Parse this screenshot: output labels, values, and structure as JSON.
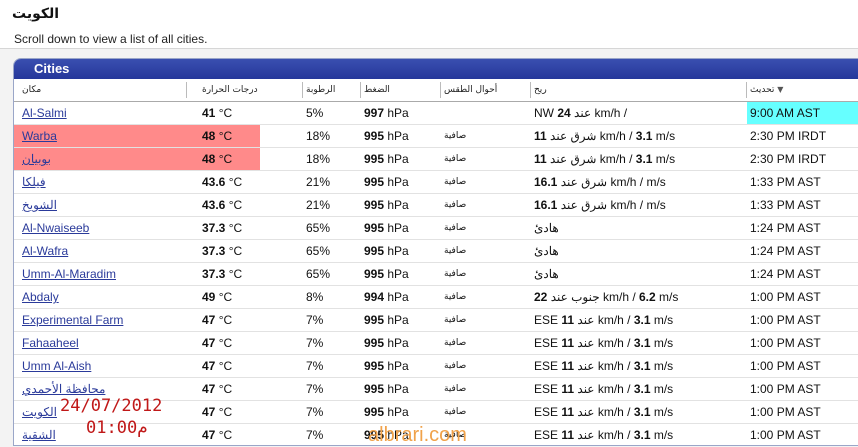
{
  "page": {
    "title": "الكويت",
    "hint": "Scroll down to view a list of all cities."
  },
  "panel": {
    "title": "Cities"
  },
  "columns": {
    "place": "مكان",
    "temperature": "درجات الحرارة",
    "humidity": "الرطوبة",
    "pressure": "الضغط",
    "conditions": "أحوال الطقس",
    "wind": "ريح",
    "updated": "تحديث"
  },
  "rows": [
    {
      "city": "Al-Salmi",
      "temp": "41",
      "temp_unit": " °C",
      "humidity": "5%",
      "pressure": "997",
      "pressure_unit": " hPa",
      "conditions": "",
      "wind_pre": "NW ",
      "wind_speed": "24",
      "wind_mid": " عند km/h / ",
      "wind_ms": "",
      "wind_post": "",
      "updated": "9:00 AM AST",
      "highlight": false,
      "highlight_updated": true
    },
    {
      "city": "Warba",
      "temp": "48",
      "temp_unit": " °C",
      "humidity": "18%",
      "pressure": "995",
      "pressure_unit": " hPa",
      "conditions": "صافية",
      "wind_pre": "",
      "wind_speed": "11",
      "wind_mid": " شرق عند km/h / ",
      "wind_ms": "3.1",
      "wind_post": " m/s",
      "updated": "2:30 PM IRDT",
      "highlight": true,
      "highlight_updated": false
    },
    {
      "city": "بوبيان",
      "temp": "48",
      "temp_unit": " °C",
      "humidity": "18%",
      "pressure": "995",
      "pressure_unit": " hPa",
      "conditions": "صافية",
      "wind_pre": "",
      "wind_speed": "11",
      "wind_mid": " شرق عند km/h / ",
      "wind_ms": "3.1",
      "wind_post": " m/s",
      "updated": "2:30 PM IRDT",
      "highlight": true,
      "highlight_updated": false
    },
    {
      "city": "فيلكا",
      "temp": "43.6",
      "temp_unit": " °C",
      "humidity": "21%",
      "pressure": "995",
      "pressure_unit": " hPa",
      "conditions": "صافية",
      "wind_pre": "",
      "wind_speed": "16.1",
      "wind_mid": " شرق عند km/h / ",
      "wind_ms": "",
      "wind_post": " m/s",
      "updated": "1:33 PM AST",
      "highlight": false,
      "highlight_updated": false
    },
    {
      "city": "الشويخ",
      "temp": "43.6",
      "temp_unit": " °C",
      "humidity": "21%",
      "pressure": "995",
      "pressure_unit": " hPa",
      "conditions": "صافية",
      "wind_pre": "",
      "wind_speed": "16.1",
      "wind_mid": " شرق عند km/h / ",
      "wind_ms": "",
      "wind_post": " m/s",
      "updated": "1:33 PM AST",
      "highlight": false,
      "highlight_updated": false
    },
    {
      "city": "Al-Nwaiseeb",
      "temp": "37.3",
      "temp_unit": " °C",
      "humidity": "65%",
      "pressure": "995",
      "pressure_unit": " hPa",
      "conditions": "صافية",
      "wind_pre": "هادئ",
      "wind_speed": "",
      "wind_mid": "",
      "wind_ms": "",
      "wind_post": "",
      "updated": "1:24 PM AST",
      "highlight": false,
      "highlight_updated": false
    },
    {
      "city": "Al-Wafra",
      "temp": "37.3",
      "temp_unit": " °C",
      "humidity": "65%",
      "pressure": "995",
      "pressure_unit": " hPa",
      "conditions": "صافية",
      "wind_pre": "هادئ",
      "wind_speed": "",
      "wind_mid": "",
      "wind_ms": "",
      "wind_post": "",
      "updated": "1:24 PM AST",
      "highlight": false,
      "highlight_updated": false
    },
    {
      "city": "Umm-Al-Maradim",
      "temp": "37.3",
      "temp_unit": " °C",
      "humidity": "65%",
      "pressure": "995",
      "pressure_unit": " hPa",
      "conditions": "صافية",
      "wind_pre": "هادئ",
      "wind_speed": "",
      "wind_mid": "",
      "wind_ms": "",
      "wind_post": "",
      "updated": "1:24 PM AST",
      "highlight": false,
      "highlight_updated": false
    },
    {
      "city": "Abdaly",
      "temp": "49",
      "temp_unit": " °C",
      "humidity": "8%",
      "pressure": "994",
      "pressure_unit": " hPa",
      "conditions": "صافية",
      "wind_pre": "",
      "wind_speed": "22",
      "wind_mid": " جنوب عند km/h / ",
      "wind_ms": "6.2",
      "wind_post": " m/s",
      "updated": "1:00 PM AST",
      "highlight": false,
      "highlight_updated": false
    },
    {
      "city": "Experimental Farm",
      "temp": "47",
      "temp_unit": " °C",
      "humidity": "7%",
      "pressure": "995",
      "pressure_unit": " hPa",
      "conditions": "صافية",
      "wind_pre": "ESE ",
      "wind_speed": "11",
      "wind_mid": " عند km/h / ",
      "wind_ms": "3.1",
      "wind_post": " m/s",
      "updated": "1:00 PM AST",
      "highlight": false,
      "highlight_updated": false
    },
    {
      "city": "Fahaaheel",
      "temp": "47",
      "temp_unit": " °C",
      "humidity": "7%",
      "pressure": "995",
      "pressure_unit": " hPa",
      "conditions": "صافية",
      "wind_pre": "ESE ",
      "wind_speed": "11",
      "wind_mid": " عند km/h / ",
      "wind_ms": "3.1",
      "wind_post": " m/s",
      "updated": "1:00 PM AST",
      "highlight": false,
      "highlight_updated": false
    },
    {
      "city": "Umm Al-Aish",
      "temp": "47",
      "temp_unit": " °C",
      "humidity": "7%",
      "pressure": "995",
      "pressure_unit": " hPa",
      "conditions": "صافية",
      "wind_pre": "ESE ",
      "wind_speed": "11",
      "wind_mid": " عند km/h / ",
      "wind_ms": "3.1",
      "wind_post": " m/s",
      "updated": "1:00 PM AST",
      "highlight": false,
      "highlight_updated": false
    },
    {
      "city": "محافظة الأحمدي",
      "temp": "47",
      "temp_unit": " °C",
      "humidity": "7%",
      "pressure": "995",
      "pressure_unit": " hPa",
      "conditions": "صافية",
      "wind_pre": "ESE ",
      "wind_speed": "11",
      "wind_mid": " عند km/h / ",
      "wind_ms": "3.1",
      "wind_post": " m/s",
      "updated": "1:00 PM AST",
      "highlight": false,
      "highlight_updated": false
    },
    {
      "city": "الكويت",
      "temp": "47",
      "temp_unit": " °C",
      "humidity": "7%",
      "pressure": "995",
      "pressure_unit": " hPa",
      "conditions": "صافية",
      "wind_pre": "ESE ",
      "wind_speed": "11",
      "wind_mid": " عند km/h / ",
      "wind_ms": "3.1",
      "wind_post": " m/s",
      "updated": "1:00 PM AST",
      "highlight": false,
      "highlight_updated": false
    },
    {
      "city": "الشقية",
      "temp": "47",
      "temp_unit": " °C",
      "humidity": "7%",
      "pressure": "995",
      "pressure_unit": " hPa",
      "conditions": "صافية",
      "wind_pre": "ESE ",
      "wind_speed": "11",
      "wind_mid": " عند km/h / ",
      "wind_ms": "3.1",
      "wind_post": " m/s",
      "updated": "1:00 PM AST",
      "highlight": false,
      "highlight_updated": false
    }
  ],
  "stamp": {
    "date": "24/07/2012",
    "time": "01:00م"
  },
  "watermark": "albrari.com",
  "colors": {
    "header_blue": "#25379a",
    "highlight_red": "#ff8a8a",
    "highlight_cyan": "#66ffff",
    "stamp_red": "#c01818",
    "watermark_orange": "#f0a24a"
  }
}
